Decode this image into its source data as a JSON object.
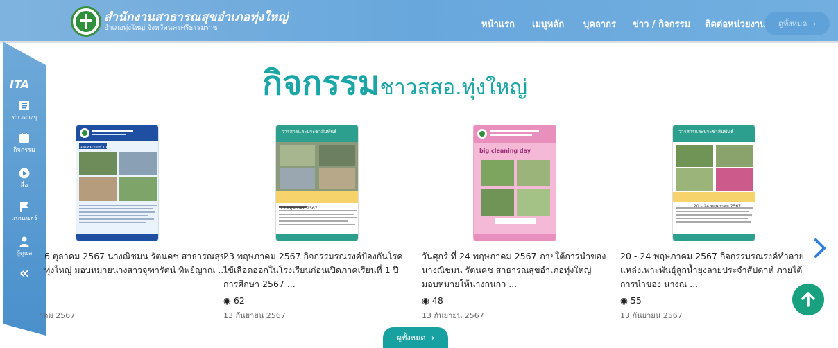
{
  "header": {
    "org_title": "สำนักงานสาธารณสุขอำเภอทุ่งใหญ่",
    "org_subtitle": "อำเภอทุ่งใหญ่ จังหวัดนครศรีธรรมราช",
    "nav": [
      "หน้าแรก",
      "เมนูหลัก",
      "บุคลากร",
      "ข่าว / กิจกรรม",
      "ติดต่อหน่วยงาน"
    ],
    "all_button": "ดูทั้งหมด →"
  },
  "sidebar": {
    "ita": "ITA",
    "items": [
      {
        "label": "ข่าวต่างๆ",
        "icon": "newspaper-icon"
      },
      {
        "label": "กิจกรรม",
        "icon": "calendar-icon"
      },
      {
        "label": "สื่อ",
        "icon": "play-icon"
      },
      {
        "label": "แบนเนอร์",
        "icon": "flag-icon"
      },
      {
        "label": "ผู้ดูแล",
        "icon": "user-icon"
      },
      {
        "label": "«",
        "icon": "collapse-icon"
      }
    ]
  },
  "page": {
    "title_big": "กิจกรรม",
    "title_small": "ชาวสสอ.ทุ่งใหญ่",
    "see_all": "ดูทั้งหมด →"
  },
  "cards": [
    {
      "text": "6 ตุลาคม 2567 นางณิชมน รัตนคช สาธารณสุข ทุ่งใหญ่ มอบหมายนางสาวจุฑารัตน์ ทิพย์ญาณ ...",
      "views": "",
      "date": "าคม 2567"
    },
    {
      "text": "23 พฤษภาคม 2567 กิจกรรมรณรงค์ป้องกันโรคไข้เลือดออกในโรงเรียนก่อนเปิดภาคเรียนที่ 1 ปีการศึกษา 2567 ...",
      "views": "62",
      "date": "13 กันยายน 2567"
    },
    {
      "text": "วันศุกร์ ที่ 24 พฤษภาคม 2567 ภายใต้การนำของนางณิชมน รัตนคช สาธารณสุขอำเภอทุ่งใหญ่ มอบหมายให้นางกนกว ...",
      "views": "48",
      "date": "13 กันยายน 2567"
    },
    {
      "text": "20 - 24 พฤษภาคม 2567 กิจกรรมรณรงค์ทำลาย แหล่งเพาะพันธุ์ลูกน้ำยุงลายประจำสัปดาห์ ภายใต้การนำของ นางณ ...",
      "views": "55",
      "date": "13 กันยายน 2567"
    }
  ],
  "thumbs": {
    "t1": {
      "label": "จดหมายข่าว"
    },
    "t2": {
      "label": "วารสารและประชาสัมพันธ์",
      "sub": "23 พฤษภาคม 2567"
    },
    "t3": {
      "label": "big cleaning day"
    },
    "t4": {
      "label": "วารสารและประชาสัมพันธ์",
      "sub": "20 – 24 พฤษภาคม 2567"
    }
  }
}
